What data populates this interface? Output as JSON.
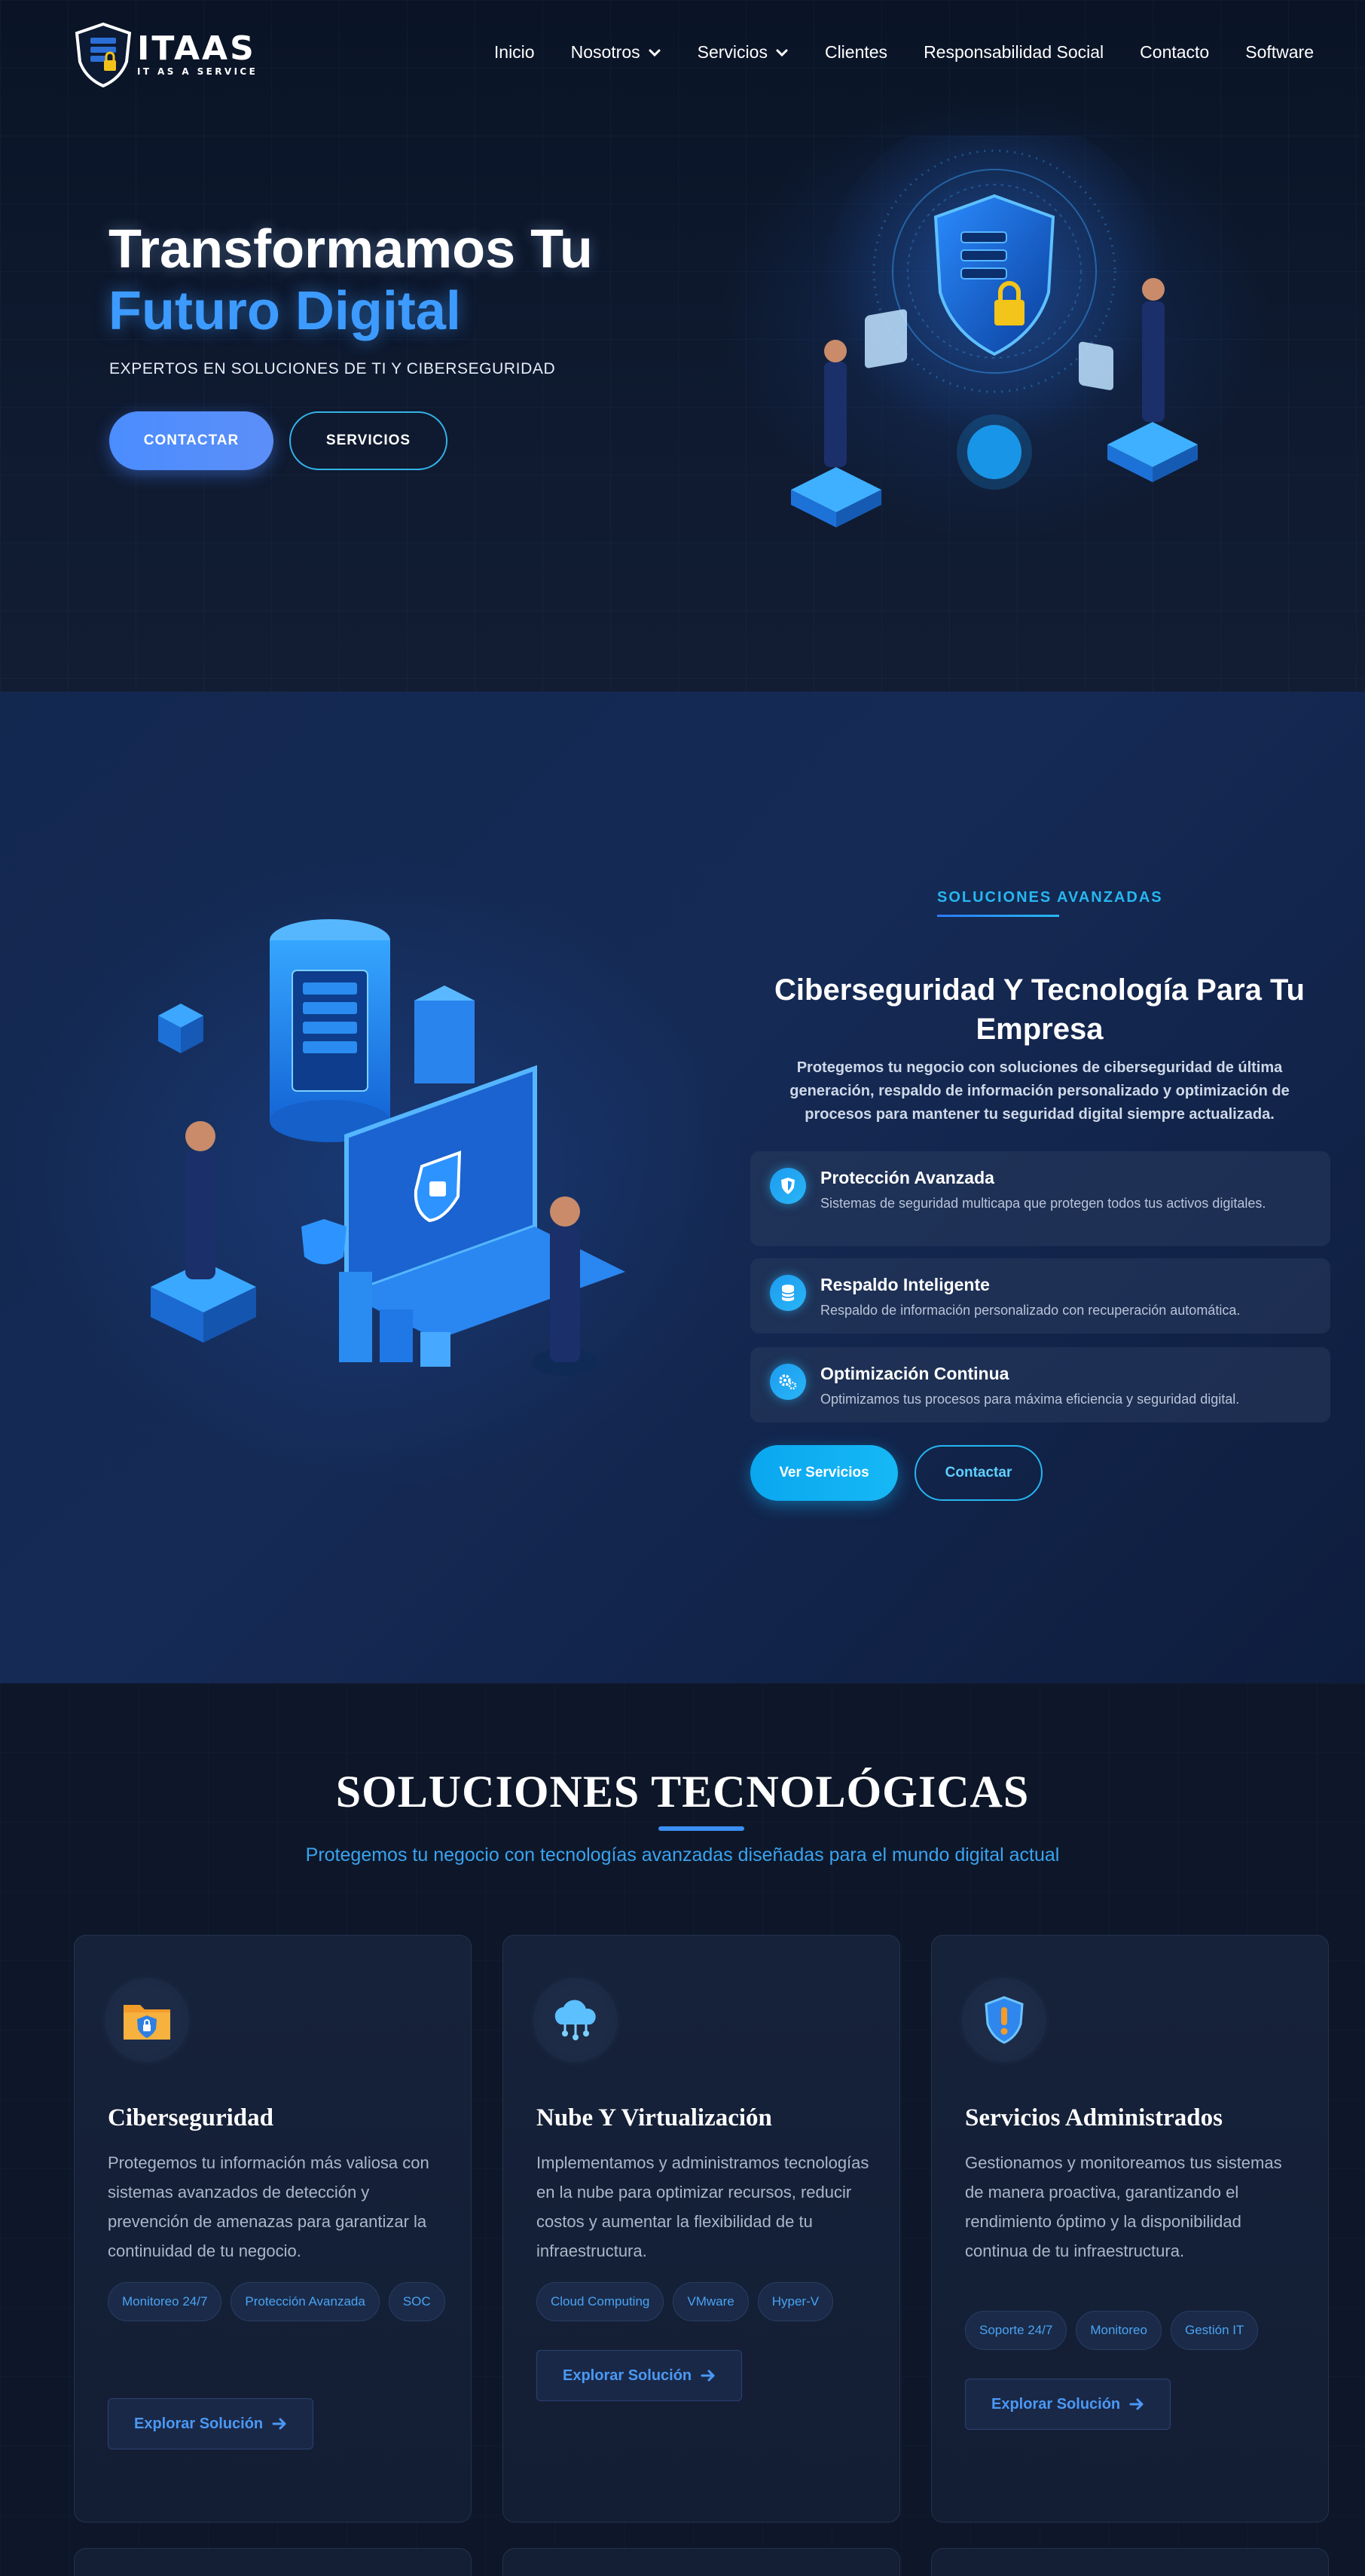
{
  "brand": {
    "name": "ITAAS",
    "tagline": "IT AS A SERVICE"
  },
  "nav": {
    "items": [
      {
        "label": "Inicio",
        "dropdown": false
      },
      {
        "label": "Nosotros",
        "dropdown": true
      },
      {
        "label": "Servicios",
        "dropdown": true
      },
      {
        "label": "Clientes",
        "dropdown": false
      },
      {
        "label": "Responsabilidad Social",
        "dropdown": false
      },
      {
        "label": "Contacto",
        "dropdown": false
      },
      {
        "label": "Software",
        "dropdown": false
      }
    ]
  },
  "hero": {
    "title_line1": "Transformamos Tu",
    "title_line2": "Futuro Digital",
    "subtitle": "EXPERTOS EN SOLUCIONES DE TI Y CIBERSEGURIDAD",
    "primary_button": "CONTACTAR",
    "secondary_button": "SERVICIOS"
  },
  "solutions": {
    "kicker": "SOLUCIONES AVANZADAS",
    "title": "Ciberseguridad Y Tecnología Para Tu Empresa",
    "description": "Protegemos tu negocio con soluciones de ciberseguridad de última generación, respaldo de información personalizado y optimización de procesos para mantener tu seguridad digital siempre actualizada.",
    "features": [
      {
        "icon": "shield-icon",
        "title": "Protección Avanzada",
        "description": "Sistemas de seguridad multicapa que protegen todos tus activos digitales."
      },
      {
        "icon": "database-icon",
        "title": "Respaldo Inteligente",
        "description": "Respaldo de información personalizado con recuperación automática."
      },
      {
        "icon": "gears-icon",
        "title": "Optimización Continua",
        "description": "Optimizamos tus procesos para máxima eficiencia y seguridad digital."
      }
    ],
    "primary_button": "Ver Servicios",
    "secondary_button": "Contactar"
  },
  "tech": {
    "title": "SOLUCIONES TECNOLÓGICAS",
    "subtitle": "Protegemos tu negocio con tecnologías avanzadas diseñadas para el mundo digital actual",
    "cards": [
      {
        "icon": "secure-folder-icon",
        "title": "Ciberseguridad",
        "description": "Protegemos tu información más valiosa con sistemas avanzados de detección y prevención de amenazas para garantizar la continuidad de tu negocio.",
        "tags": [
          "Monitoreo 24/7",
          "Protección Avanzada",
          "SOC"
        ],
        "button": "Explorar Solución"
      },
      {
        "icon": "cloud-icon",
        "title": "Nube Y Virtualización",
        "description": "Implementamos y administramos tecnologías en la nube para optimizar recursos, reducir costos y aumentar la flexibilidad de tu infraestructura.",
        "tags": [
          "Cloud Computing",
          "VMware",
          "Hyper-V"
        ],
        "button": "Explorar Solución"
      },
      {
        "icon": "alert-shield-icon",
        "title": "Servicios Administrados",
        "description": "Gestionamos y monitoreamos tus sistemas de manera proactiva, garantizando el rendimiento óptimo y la disponibilidad continua de tu infraestructura.",
        "tags": [
          "Soporte 24/7",
          "Monitoreo",
          "Gestión IT"
        ],
        "button": "Explorar Solución"
      }
    ]
  },
  "colors": {
    "accent": "#3d9bff",
    "cyan": "#27b7f0",
    "bg": "#0d1729"
  }
}
